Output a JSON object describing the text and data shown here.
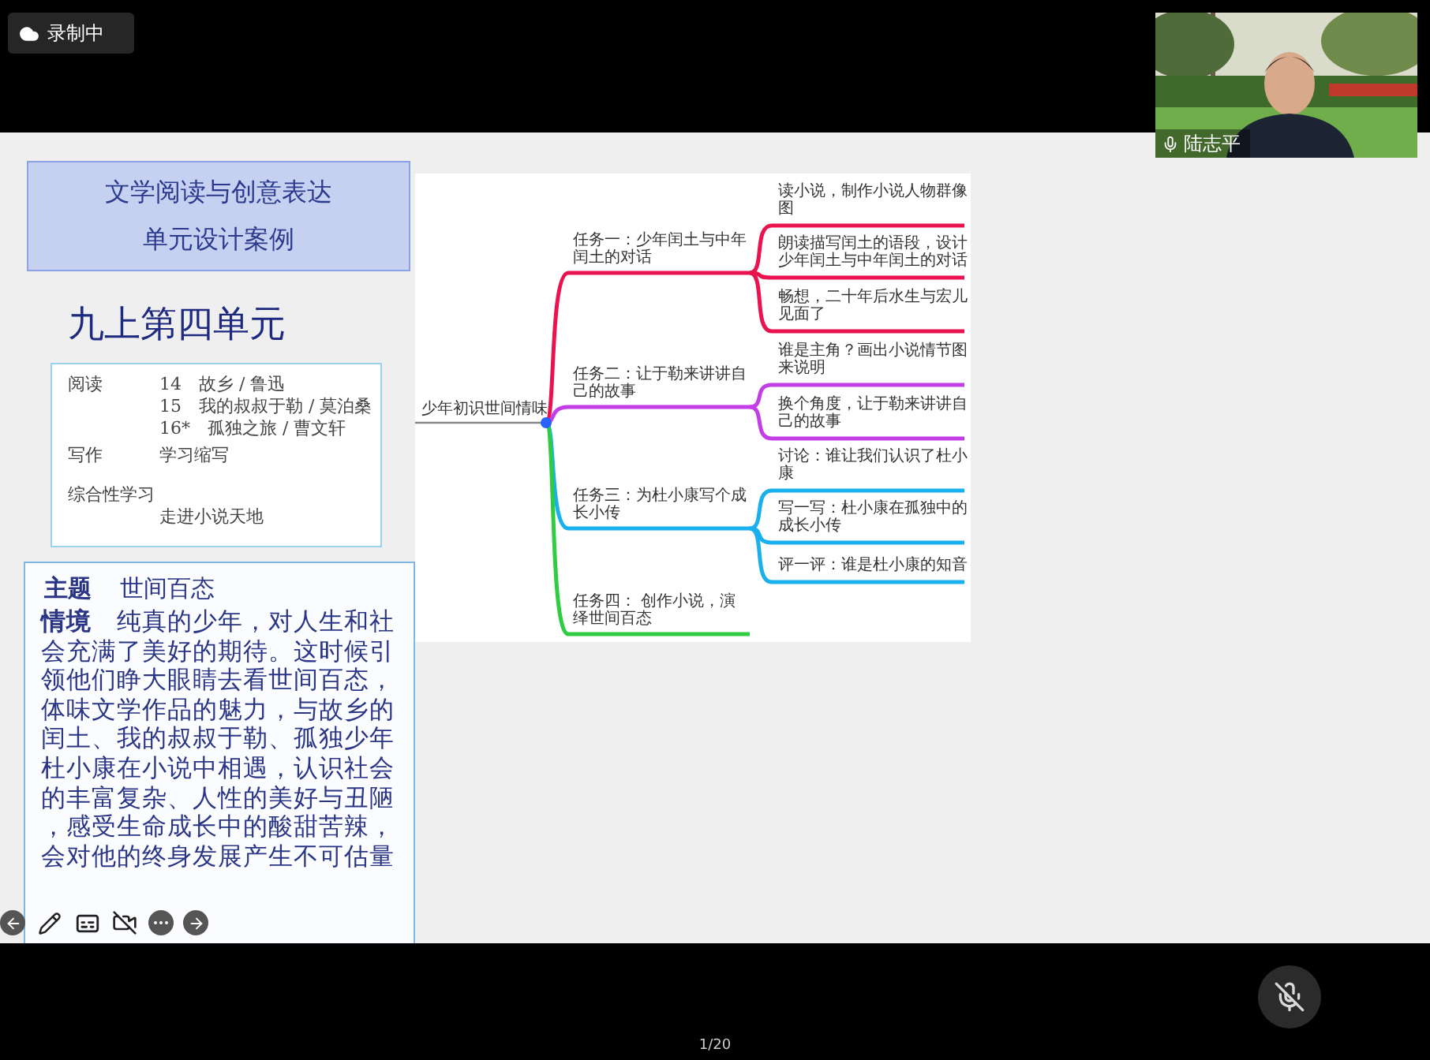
{
  "recording_badge": {
    "label": "录制中"
  },
  "video_tile": {
    "kind": "picture",
    "name": "陆志平"
  },
  "slide": {
    "title_lines": [
      "文学阅读与创意表达",
      "单元设计案例"
    ],
    "unit": "九上第四单元",
    "contents": [
      {
        "category": "阅读",
        "items": [
          "14　故乡 / 鲁迅",
          "15　我的叔叔于勒 / 莫泊桑",
          "16*　孤独之旅 / 曹文轩"
        ]
      },
      {
        "category": "写作",
        "items": [
          "学习缩写"
        ]
      },
      {
        "category": "综合性学习",
        "items": [
          "走进小说天地"
        ]
      }
    ],
    "theme": {
      "label": "主题",
      "value": "世间百态"
    },
    "context": "**情境**　纯真的少年，对人生和社会充满了美好的期待。这时候引领他们睁大眼睛去看世间百态，体味文学作品的魅力，与故乡的闰土、我的叔叔于勒、孤独少年杜小康在小说中相遇，认识社会的丰富复杂、人性的美好与丑陋，感受生命成长中的酸甜苦辣，会对他的终身发展产生不可估量",
    "mindmap": {
      "root": "少年初识世间情味",
      "branches": [
        {
          "label": "任务一：少年闰土与中年闰土的对话",
          "color": "#e8134f",
          "children": [
            "读小说，制作小说人物群像图",
            "朗读描写闰土的语段，设计少年闰土与中年闰土的对话",
            "畅想，二十年后水生与宏儿见面了"
          ]
        },
        {
          "label": "任务二：让于勒来讲讲自己的故事",
          "color": "#c23fe6",
          "children": [
            "谁是主角？画出小说情节图来说明",
            "换个角度，让于勒来讲讲自己的故事"
          ]
        },
        {
          "label": "任务三：为杜小康写个成长小传",
          "color": "#1ab0ee",
          "children": [
            "讨论：谁让我们认识了杜小康",
            "写一写：杜小康在孤独中的成长小传",
            "评一评：谁是杜小康的知音"
          ]
        },
        {
          "label": "任务四： 创作小说，演绎世间百态",
          "color": "#2ecc40"
        }
      ]
    }
  },
  "microphone": {
    "muted": true
  },
  "page_indicator": "1/20"
}
